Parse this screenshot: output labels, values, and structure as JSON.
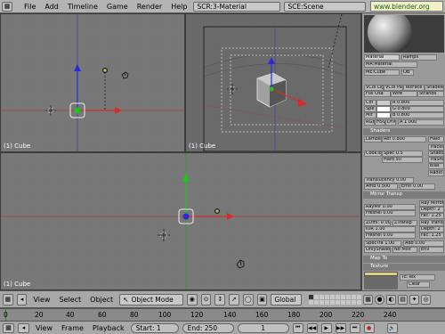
{
  "menubar": {
    "items": [
      "File",
      "Add",
      "Timeline",
      "Game",
      "Render",
      "Help"
    ],
    "screen": "SCR:3-Material",
    "scene": "SCE:Scene",
    "url": "www.blender.org"
  },
  "viewports": {
    "top_left_label": "(1) Cube",
    "top_right_label": "(1) Cube",
    "bottom_label": "(1) Cube"
  },
  "material_panel": {
    "tabs": [
      "Material",
      "Ramps"
    ],
    "ma_name": "MA:Material",
    "me_name": "ME:Cube",
    "ob_label": "OB",
    "mode_buttons": [
      "VCol Light",
      "VCol Paint",
      "TexFace",
      "Shadeless",
      "Full Osa",
      "Wire",
      "Strands"
    ],
    "rgb": [
      {
        "label": "Col",
        "value": "R 0.800"
      },
      {
        "label": "Spe",
        "value": "G 0.800"
      },
      {
        "label": "Mir",
        "value": "B 0.800"
      }
    ],
    "rgb_modes": [
      "RGB",
      "HSV",
      "DYN",
      "A 1.000"
    ],
    "shaders_header": "Shaders",
    "diffuse_shader": "Lambert",
    "diffuse_ref": "Ref 0.800",
    "halo": "Halo",
    "spec_shader": "CookTorr",
    "spec_value": "Spec 0.5",
    "hard_value": "Hard 50",
    "shader_toggles": [
      "Traceable",
      "Shadow",
      "TraShado",
      "Bias",
      "Radio"
    ],
    "translucency": "Translucency 0.00",
    "amb": "Amb 0.500",
    "emit": "Emit 0.00",
    "mirror_header": "Mirror Transp",
    "ray_mirror": "Ray Mirror",
    "raymir": "RayMir 0.00",
    "fresnel": "Fresnel 0.00",
    "depth": "Depth: 2",
    "fac": "Fac: 1.25",
    "zoffs": "ZOffs: 0.000",
    "ztransp": "ZTransp",
    "ray_transp": "Ray Transp",
    "ior": "IOR 1.00",
    "spectra": "SpecTra 1.00",
    "add": "Add 0.00",
    "onlyshadow": "OnlyShadow",
    "no_mist": "No Mist",
    "env": "Env",
    "map_to": "Map To",
    "texture": "Texture",
    "tex_name": "TE:Tex",
    "clear": "Clear"
  },
  "view_header": {
    "items": [
      "View",
      "Select",
      "Object"
    ],
    "mode": "Object Mode",
    "orientation": "Global"
  },
  "timeline": {
    "ticks": [
      "0",
      "20",
      "40",
      "60",
      "80",
      "100",
      "120",
      "140",
      "160",
      "180",
      "200",
      "220",
      "240"
    ]
  },
  "timeline_header": {
    "items": [
      "View",
      "Frame",
      "Playback"
    ],
    "start": "Start: 1",
    "end": "End: 250",
    "current": "1"
  }
}
